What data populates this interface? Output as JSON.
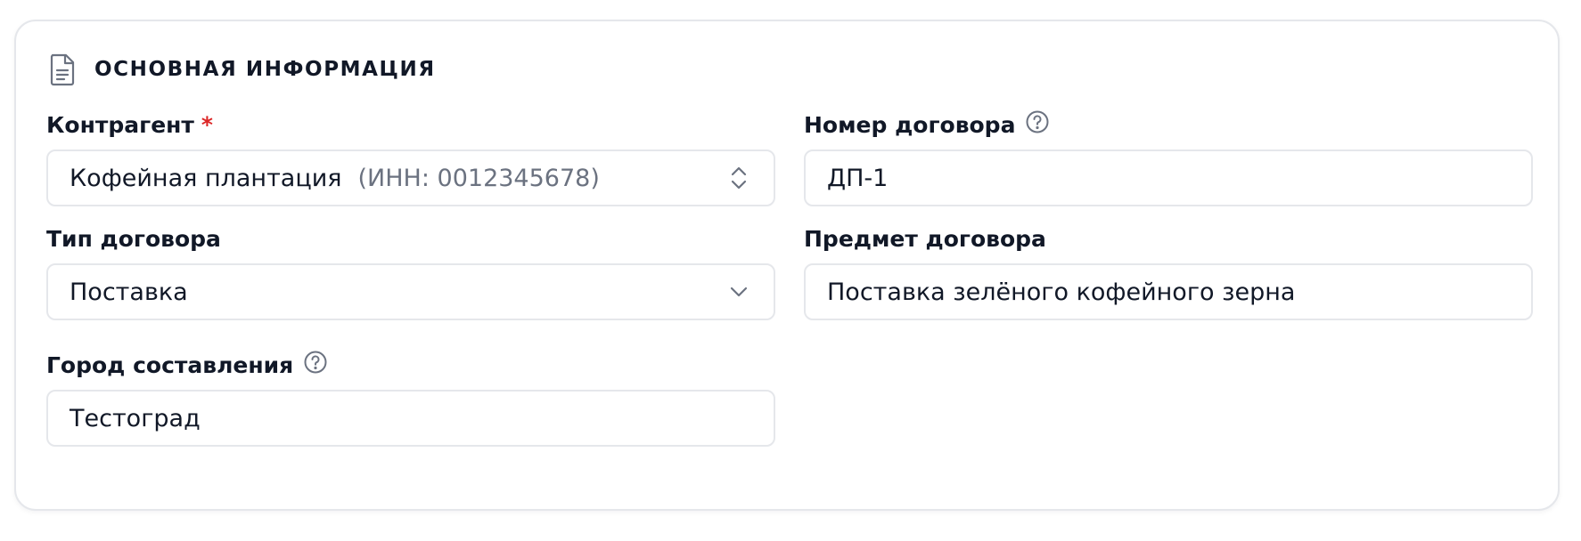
{
  "section": {
    "title": "ОСНОВНАЯ ИНФОРМАЦИЯ",
    "icon": "document-icon"
  },
  "fields": {
    "counterparty": {
      "label": "Контрагент",
      "required_mark": "*",
      "value": "Кофейная плантация",
      "hint": "(ИНН: 0012345678)"
    },
    "contract_number": {
      "label": "Номер договора",
      "value": "ДП-1"
    },
    "contract_type": {
      "label": "Тип договора",
      "value": "Поставка"
    },
    "contract_subject": {
      "label": "Предмет договора",
      "value": "Поставка зелёного кофейного зерна"
    },
    "city": {
      "label": "Город составления",
      "value": "Тестоград"
    }
  },
  "colors": {
    "required": "#dc2626",
    "hint_text": "#6b7280",
    "border": "#e5e7eb",
    "icon": "#6b7280"
  }
}
